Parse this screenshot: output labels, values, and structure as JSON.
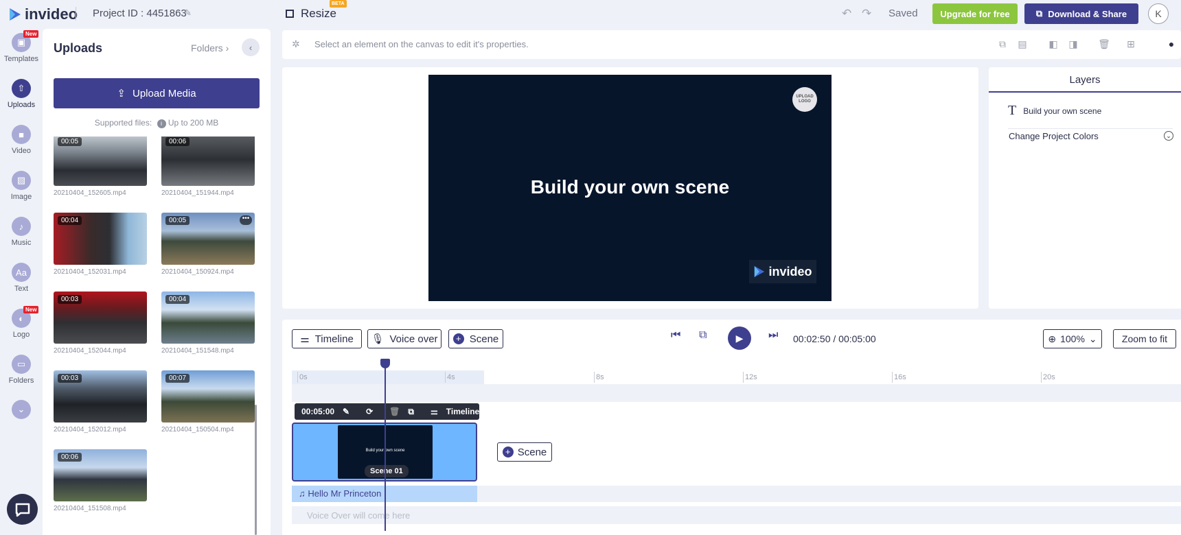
{
  "topbar": {
    "brand": "invideo",
    "project_id": "Project ID : 4451863",
    "resize_label": "Resize",
    "beta_badge": "BETA",
    "saved_label": "Saved",
    "upgrade_label": "Upgrade for free",
    "download_label": "Download & Share",
    "avatar_initial": "K"
  },
  "rail": {
    "items": [
      {
        "label": "Templates",
        "badge": "New"
      },
      {
        "label": "Uploads"
      },
      {
        "label": "Video"
      },
      {
        "label": "Image"
      },
      {
        "label": "Music"
      },
      {
        "label": "Text"
      },
      {
        "label": "Logo",
        "badge": "New"
      },
      {
        "label": "Folders"
      }
    ]
  },
  "uploads": {
    "title": "Uploads",
    "folders_link": "Folders",
    "upload_button": "Upload Media",
    "supported_label": "Supported files:",
    "size_limit": "Up to 200 MB",
    "files": [
      {
        "duration": "00:05",
        "name": "20210404_152605.mp4"
      },
      {
        "duration": "00:06",
        "name": "20210404_151944.mp4"
      },
      {
        "duration": "00:04",
        "name": "20210404_152031.mp4"
      },
      {
        "duration": "00:05",
        "name": "20210404_150924.mp4"
      },
      {
        "duration": "00:03",
        "name": "20210404_152044.mp4"
      },
      {
        "duration": "00:04",
        "name": "20210404_151548.mp4"
      },
      {
        "duration": "00:03",
        "name": "20210404_152012.mp4"
      },
      {
        "duration": "00:07",
        "name": "20210404_150504.mp4"
      },
      {
        "duration": "00:06",
        "name": "20210404_151508.mp4"
      }
    ]
  },
  "properties": {
    "hint": "Select an element on the canvas to edit it's properties."
  },
  "canvas": {
    "headline": "Build your own scene",
    "logo_placeholder": "UPLOAD LOGO",
    "watermark": "invideo",
    "background_color": "#07152b"
  },
  "layers": {
    "title": "Layers",
    "item": "Build your own scene",
    "change_colors": "Change Project Colors"
  },
  "timeline": {
    "timeline_btn": "Timeline",
    "voiceover_btn": "Voice over",
    "scene_btn": "Scene",
    "current_time": "00:02:50",
    "separator": "/",
    "total_time": "00:05:00",
    "zoom": "100%",
    "zoom_fit": "Zoom to fit",
    "ticks": [
      "0s",
      "4s",
      "8s",
      "12s",
      "16s",
      "20s"
    ],
    "scene_duration": "00:05:00",
    "scene_toolbar_timeline": "Timeline",
    "scene_label": "Scene 01",
    "scene_thumb_text": "Build your own scene",
    "add_scene": "Scene",
    "audio_label": "Hello Mr Princeton",
    "voiceover_placeholder": "Voice Over will come here"
  },
  "colors": {
    "accent": "#3f3f8f",
    "upgrade": "#8cc63f",
    "new_badge": "#e3232f",
    "scene_clip": "#6eb6ff"
  }
}
